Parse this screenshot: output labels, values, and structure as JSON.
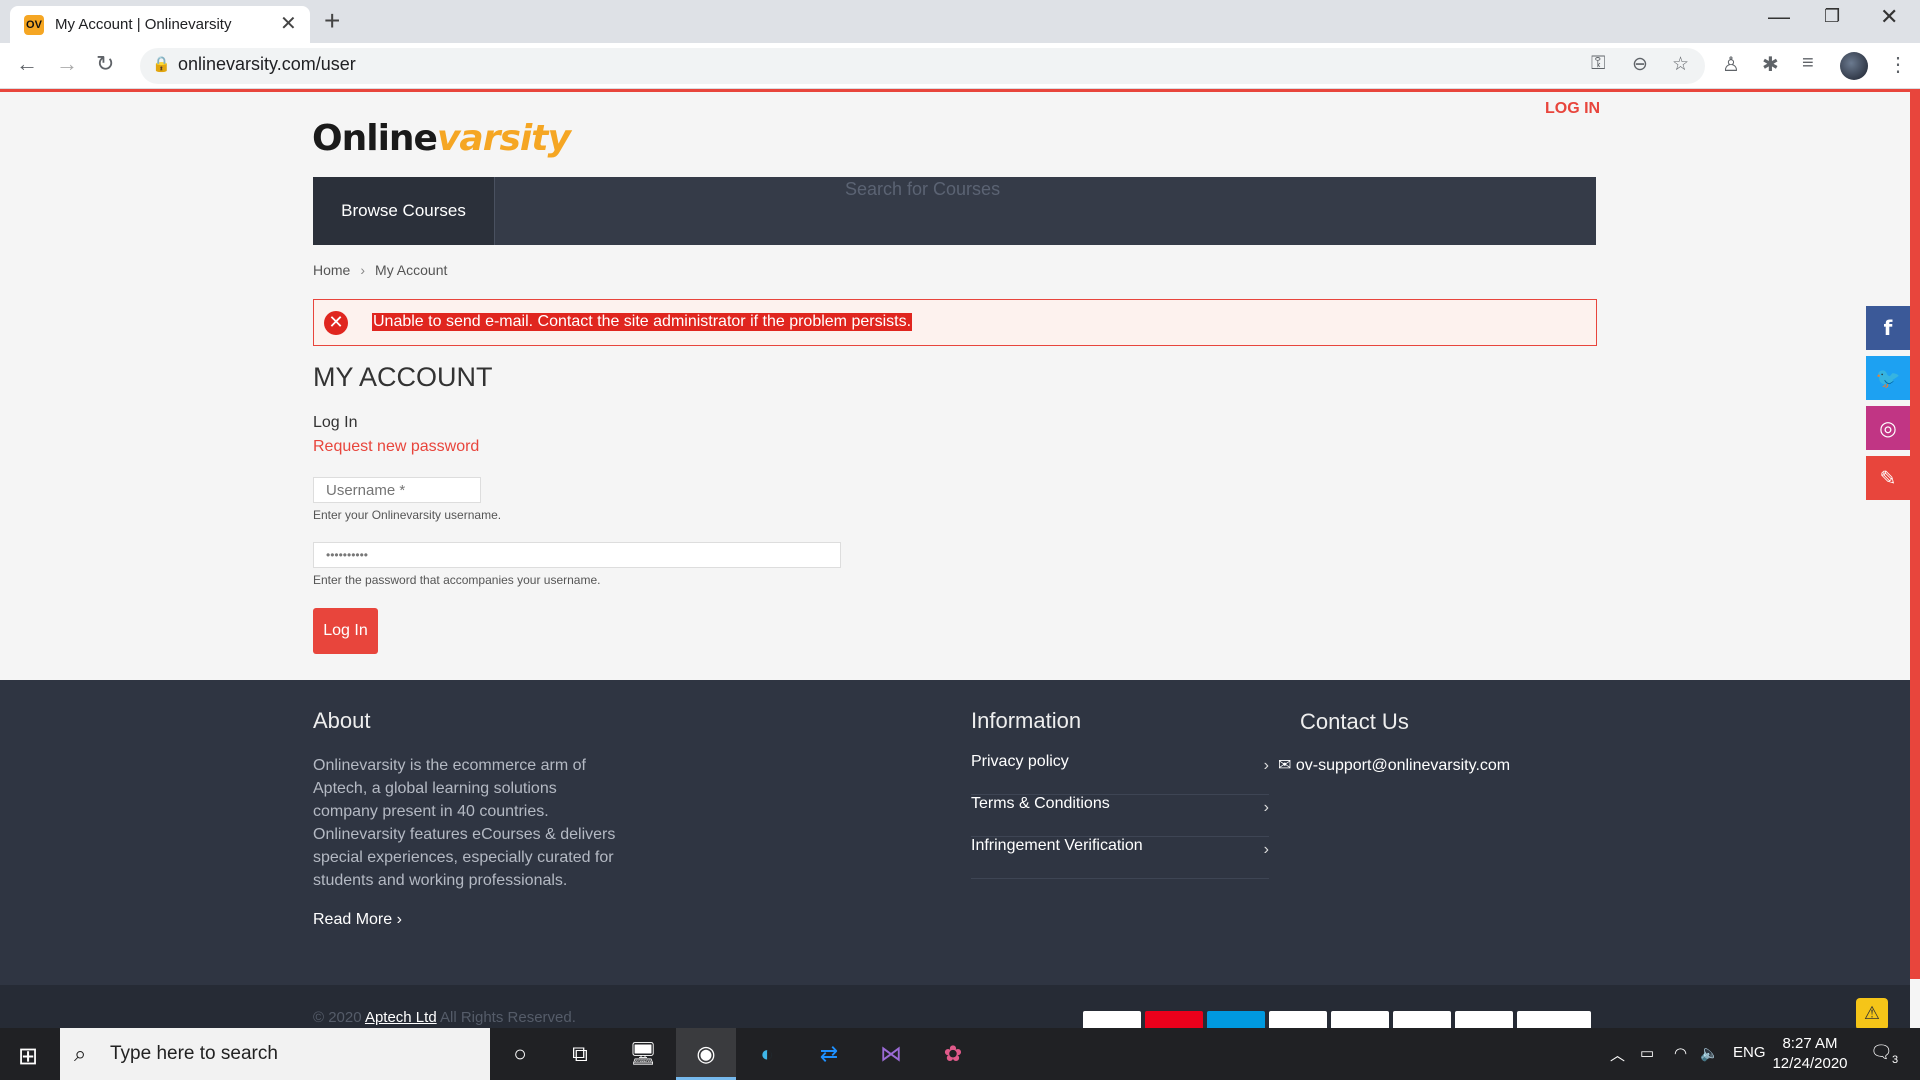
{
  "browser": {
    "tab_title": "My Account | Onlinevarsity",
    "favicon_text": "OV",
    "url": "onlinevarsity.com/user"
  },
  "site": {
    "login_link": "LOG IN",
    "logo_part1": "Online",
    "logo_part2": "varsity",
    "browse_label": "Browse Courses",
    "search_placeholder": "Search for Courses"
  },
  "breadcrumb": {
    "home": "Home",
    "separator": "›",
    "current": "My Account"
  },
  "alert": {
    "message": "Unable to send e-mail. Contact the site administrator if the problem persists."
  },
  "account": {
    "heading": "MY ACCOUNT",
    "login_tab": "Log In",
    "request_password": "Request new password",
    "username_placeholder": "Username *",
    "username_help": "Enter your Onlinevarsity username.",
    "password_value": "••••••••••",
    "password_help": "Enter the password that accompanies your username.",
    "submit_label": "Log In"
  },
  "footer": {
    "about_heading": "About",
    "about_text": "Onlinevarsity is the ecommerce arm of Aptech, a global learning solutions company present in 40 countries. Onlinevarsity features eCourses & delivers special experiences, especially curated for students and working professionals.",
    "read_more": "Read More",
    "info_heading": "Information",
    "info_links": [
      "Privacy policy",
      "Terms & Conditions",
      "Infringement Verification"
    ],
    "contact_heading": "Contact Us",
    "contact_email": "ov-support@onlinevarsity.com",
    "copyright_prefix": "© 2020",
    "copyright_company": "Aptech Ltd",
    "copyright_suffix": "All Rights Reserved."
  },
  "taskbar": {
    "search_text": "Type here to search",
    "language": "ENG",
    "time": "8:27 AM",
    "date": "12/24/2020",
    "notification_count": "3"
  },
  "colors": {
    "accent": "#e8453c",
    "nav_bg": "#353b48",
    "footer_bg": "#2f3542"
  }
}
